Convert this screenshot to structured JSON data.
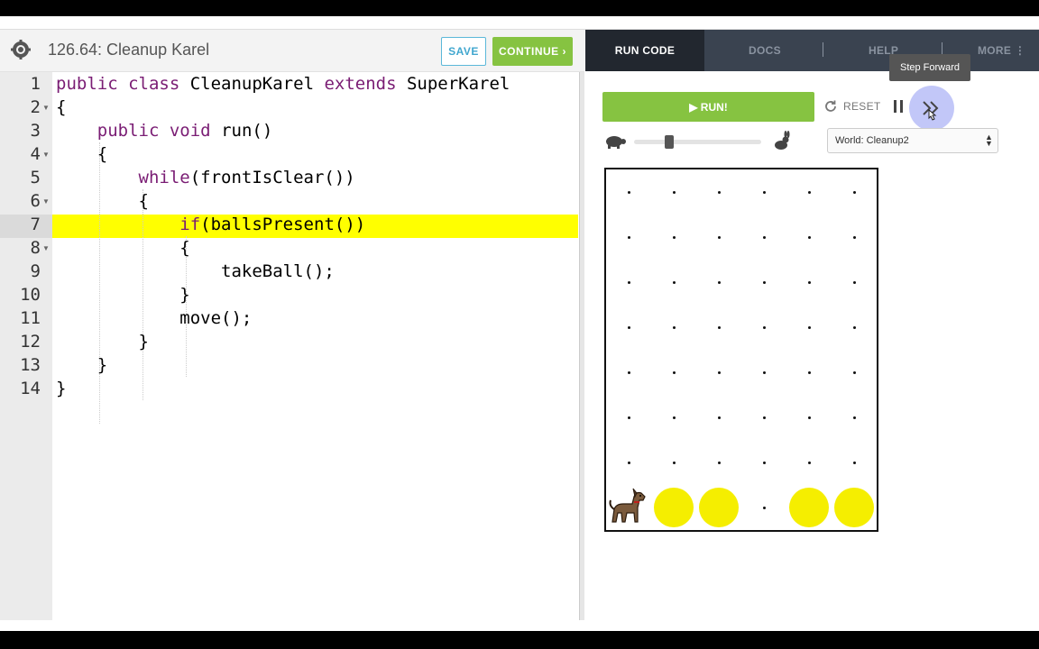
{
  "header": {
    "title": "126.64: Cleanup Karel",
    "save_label": "SAVE",
    "continue_label": "CONTINUE ›"
  },
  "editor": {
    "highlighted_line": 7,
    "lines": [
      {
        "n": "1",
        "text": "public class CleanupKarel extends SuperKarel"
      },
      {
        "n": "2",
        "text": "{"
      },
      {
        "n": "3",
        "text": "    public void run()"
      },
      {
        "n": "4",
        "text": "    {"
      },
      {
        "n": "5",
        "text": "        while(frontIsClear())"
      },
      {
        "n": "6",
        "text": "        {"
      },
      {
        "n": "7",
        "text": "            if(ballsPresent())"
      },
      {
        "n": "8",
        "text": "            {"
      },
      {
        "n": "9",
        "text": "                takeBall();"
      },
      {
        "n": "10",
        "text": "            }"
      },
      {
        "n": "11",
        "text": "            move();"
      },
      {
        "n": "12",
        "text": "        }"
      },
      {
        "n": "13",
        "text": "    }"
      },
      {
        "n": "14",
        "text": "}"
      }
    ]
  },
  "tabs": {
    "run_code": "RUN CODE",
    "docs": "DOCS",
    "help": "HELP",
    "more": "MORE ⋮"
  },
  "controls": {
    "run_label": "▶  RUN!",
    "reset_label": "RESET",
    "tooltip": "Step Forward",
    "world_select": "World: Cleanup2",
    "speed_fraction": 0.25
  },
  "world": {
    "cols": 6,
    "rows": 8,
    "karel": {
      "col": 1,
      "row": 1
    },
    "balls": [
      {
        "col": 2,
        "row": 1
      },
      {
        "col": 3,
        "row": 1
      },
      {
        "col": 5,
        "row": 1
      },
      {
        "col": 6,
        "row": 1
      }
    ]
  },
  "colors": {
    "green": "#86c341",
    "highlight": "#ffff00",
    "keyword": "#7a1d74",
    "ball": "#f5ee00",
    "dark_nav": "#3a4350"
  },
  "icons": [
    "gear-icon",
    "refresh-icon",
    "pause-icon",
    "step-forward-icon",
    "turtle-icon",
    "rabbit-icon",
    "karel-dog-icon",
    "select-arrows-icon"
  ]
}
